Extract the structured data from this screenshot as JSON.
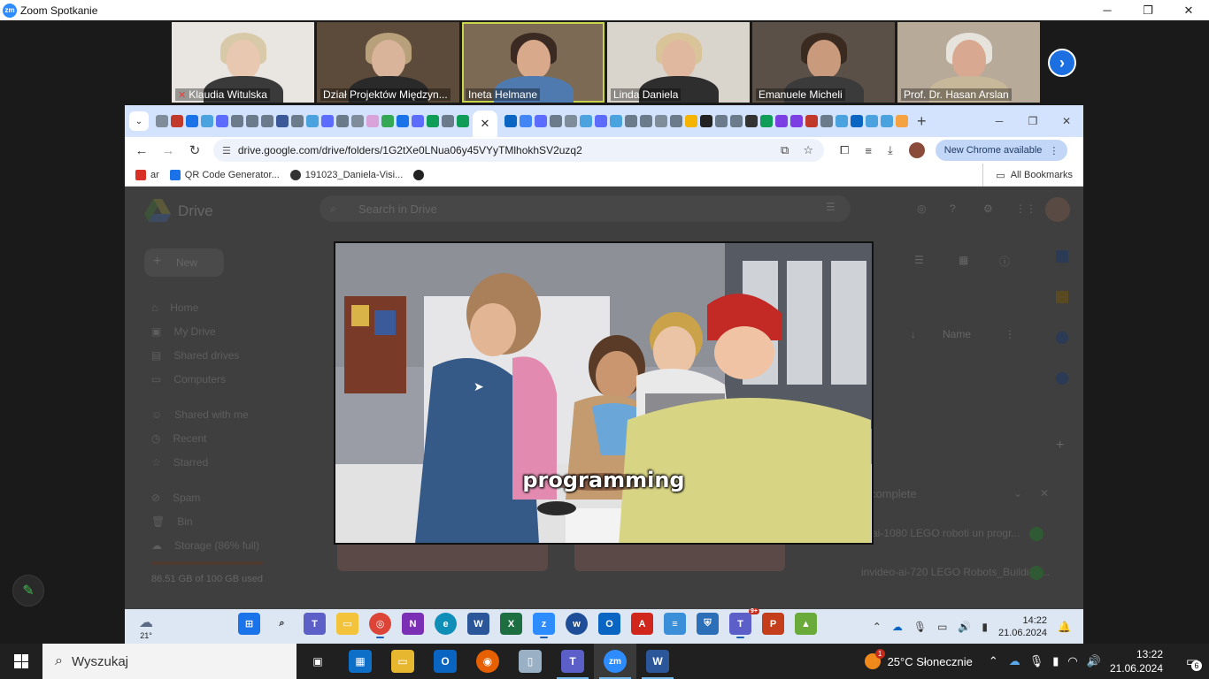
{
  "zoom": {
    "title": "Zoom Spotkanie",
    "logo_text": "zm",
    "window_controls": [
      "─",
      "❐",
      "✕"
    ]
  },
  "participants": [
    {
      "name": "Klaudia Witulska",
      "muted": true
    },
    {
      "name": "Dział Projektów Międzyn...",
      "muted": false
    },
    {
      "name": "Ineta Helmane",
      "muted": false,
      "active": true
    },
    {
      "name": "Linda Daniela",
      "muted": false
    },
    {
      "name": "Emanuele Micheli",
      "muted": false
    },
    {
      "name": "Prof. Dr. Hasan Arslan",
      "muted": false
    }
  ],
  "next_page_glyph": "›",
  "chrome": {
    "url": "drive.google.com/drive/folders/1G2tXe0LNua06y45VYyTMlhokhSV2uzq2",
    "new_chrome_label": "New Chrome available",
    "bookmarks": [
      {
        "label": "ar",
        "color": "#d93025"
      },
      {
        "label": "QR Code Generator...",
        "color": "#1a73e8"
      },
      {
        "label": "191023_Daniela-Visi...",
        "color": "#333333"
      }
    ],
    "all_bookmarks_label": "All Bookmarks"
  },
  "drive": {
    "logo_label": "Drive",
    "search_placeholder": "Search in Drive",
    "new_label": "New",
    "sidebar": [
      "Home",
      "My Drive",
      "Shared drives",
      "Computers",
      "Shared with me",
      "Recent",
      "Starred",
      "Spam",
      "Bin",
      "Storage (86% full)"
    ],
    "storage_text": "86.51 GB of 100 GB used",
    "sort_label": "Name",
    "upload_status": "complete",
    "uploads": [
      "ai-1080 LEGO roboti un progr...",
      "invideo-ai-720 LEGO Robots_Building..."
    ]
  },
  "video": {
    "caption": "programming"
  },
  "remote_taskbar": {
    "temperature": "21°",
    "time": "14:22",
    "date": "21.06.2024",
    "teams_badge": "9+"
  },
  "taskbar": {
    "search_placeholder": "Wyszukaj",
    "weather": "25°C  Słonecznie",
    "time": "13:22",
    "date": "21.06.2024",
    "notification_count": "6"
  }
}
